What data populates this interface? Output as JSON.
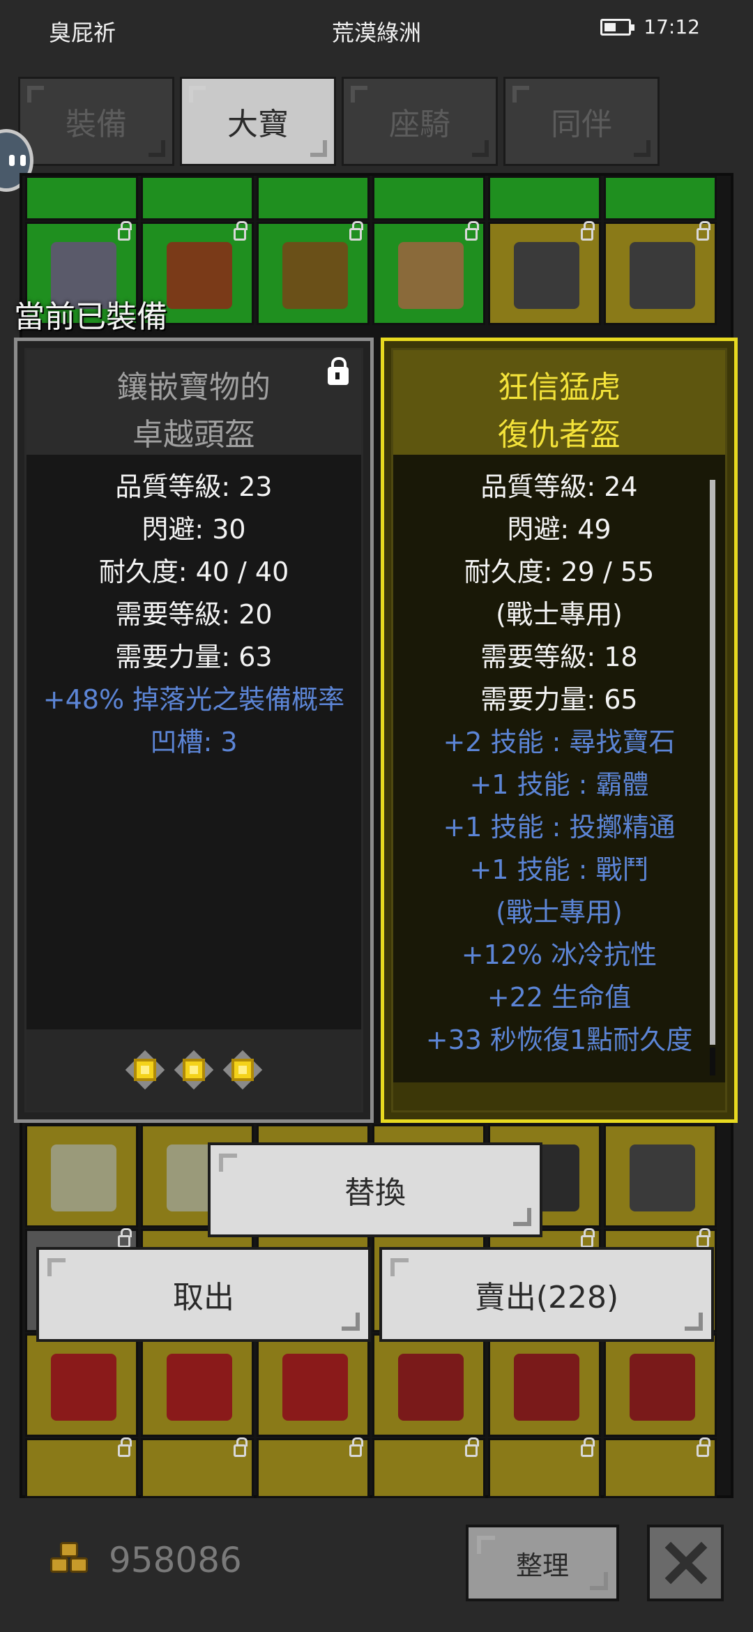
{
  "status_bar": {
    "left_text": "臭屁祈",
    "center_title": "荒漠綠洲",
    "time": "17:12"
  },
  "tabs": [
    {
      "label": "裝備",
      "active": false
    },
    {
      "label": "大寶",
      "active": true
    },
    {
      "label": "座騎",
      "active": false
    },
    {
      "label": "同伴",
      "active": false
    }
  ],
  "equipped_label": "當前已裝備",
  "left_item": {
    "name_line1": "鑲嵌寶物的",
    "name_line2": "卓越頭盔",
    "stats": [
      "品質等級: 23",
      "閃避: 30",
      "耐久度: 40 / 40",
      "需要等級: 20",
      "需要力量: 63"
    ],
    "magic_props": [
      "+48% 掉落光之裝備概率",
      "凹槽: 3"
    ],
    "socket_count": 3
  },
  "right_item": {
    "name_line1": "狂信猛虎",
    "name_line2": "復仇者盔",
    "stats": [
      "品質等級: 24",
      "閃避: 49",
      "耐久度: 29 / 55",
      "(戰士專用)",
      "需要等級: 18",
      "需要力量: 65"
    ],
    "magic_props": [
      "+2 技能 : 尋找寶石",
      "+1 技能 : 霸體",
      "+1 技能 : 投擲精通",
      "+1 技能 : 戰鬥",
      "(戰士專用)",
      "+12% 冰冷抗性",
      "+22 生命值",
      "+33 秒恢復1點耐久度"
    ]
  },
  "buttons": {
    "replace": "替換",
    "take_out": "取出",
    "sell": "賣出(228)",
    "sort": "整理"
  },
  "gold": "958086",
  "colors": {
    "background": "#292929",
    "unique_item_name": "#f4e33a",
    "magic_prop_blue": "#5c85d6",
    "selected_border": "#e8da20",
    "slot_green": "#1f8f1f",
    "slot_gold": "#8a7a18"
  }
}
